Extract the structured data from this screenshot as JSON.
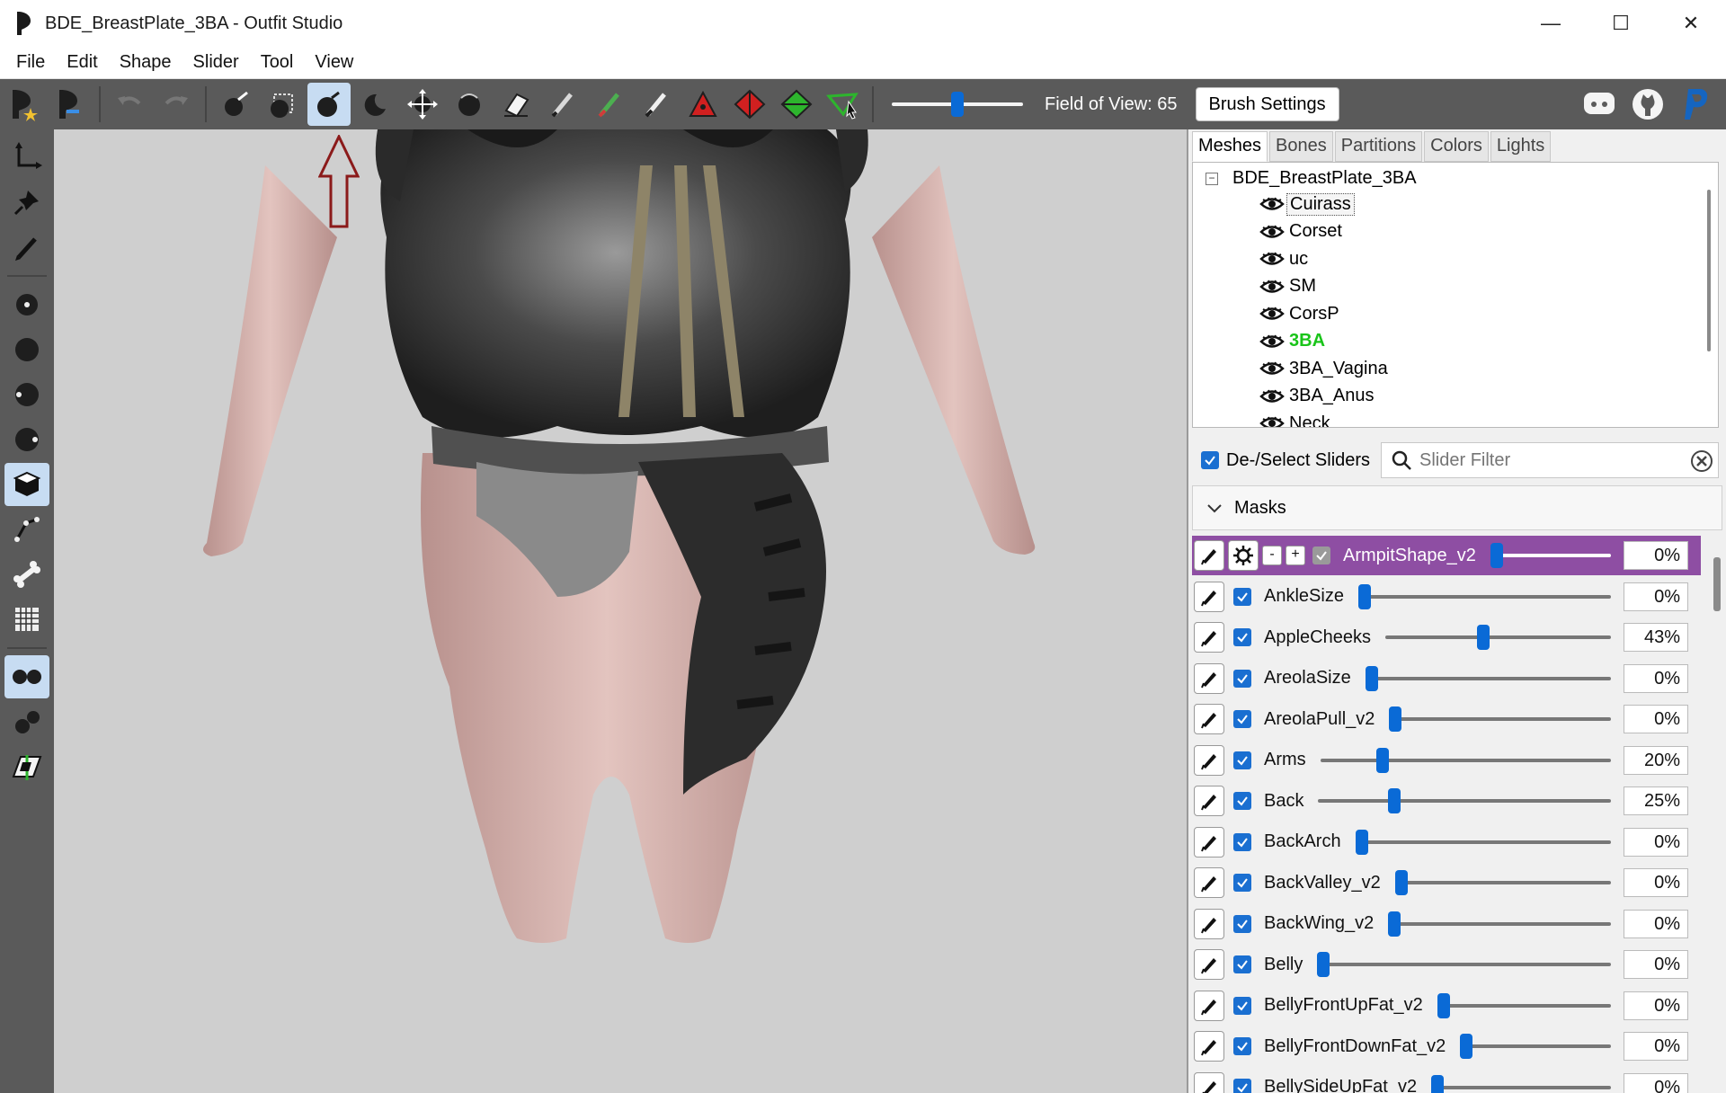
{
  "window": {
    "title": "BDE_BreastPlate_3BA - Outfit Studio",
    "minimize": "—",
    "maximize": "☐",
    "close": "✕"
  },
  "menu": [
    "File",
    "Edit",
    "Shape",
    "Slider",
    "Tool",
    "View"
  ],
  "toolbar": {
    "fov_label": "Field of View: 65",
    "fov_value": 65,
    "brush_settings_label": "Brush Settings",
    "active_tool": "inflate-brush"
  },
  "tabs": [
    {
      "label": "Meshes",
      "active": true
    },
    {
      "label": "Bones",
      "active": false
    },
    {
      "label": "Partitions",
      "active": false
    },
    {
      "label": "Colors",
      "active": false
    },
    {
      "label": "Lights",
      "active": false
    }
  ],
  "mesh_tree": {
    "root": "BDE_BreastPlate_3BA",
    "collapse_glyph": "−",
    "items": [
      {
        "label": "Cuirass",
        "state": "selected"
      },
      {
        "label": "Corset",
        "state": "normal"
      },
      {
        "label": "uc",
        "state": "normal"
      },
      {
        "label": "SM",
        "state": "normal"
      },
      {
        "label": "CorsP",
        "state": "normal"
      },
      {
        "label": "3BA",
        "state": "highlight"
      },
      {
        "label": "3BA_Vagina",
        "state": "normal"
      },
      {
        "label": "3BA_Anus",
        "state": "normal"
      },
      {
        "label": "Neck",
        "state": "normal"
      }
    ]
  },
  "slider_panel": {
    "deselect_label": "De-/Select Sliders",
    "filter_placeholder": "Slider Filter",
    "masks_label": "Masks",
    "minus": "-",
    "plus": "+",
    "sliders": [
      {
        "name": "ArmpitShape_v2",
        "value": "0%",
        "fraction": 0.0,
        "selected": true
      },
      {
        "name": "AnkleSize",
        "value": "0%",
        "fraction": 0.0
      },
      {
        "name": "AppleCheeks",
        "value": "43%",
        "fraction": 0.43
      },
      {
        "name": "AreolaSize",
        "value": "0%",
        "fraction": 0.0
      },
      {
        "name": "AreolaPull_v2",
        "value": "0%",
        "fraction": 0.0
      },
      {
        "name": "Arms",
        "value": "20%",
        "fraction": 0.2
      },
      {
        "name": "Back",
        "value": "25%",
        "fraction": 0.25
      },
      {
        "name": "BackArch",
        "value": "0%",
        "fraction": 0.0
      },
      {
        "name": "BackValley_v2",
        "value": "0%",
        "fraction": 0.0
      },
      {
        "name": "BackWing_v2",
        "value": "0%",
        "fraction": 0.0
      },
      {
        "name": "Belly",
        "value": "0%",
        "fraction": 0.0
      },
      {
        "name": "BellyFrontUpFat_v2",
        "value": "0%",
        "fraction": 0.0
      },
      {
        "name": "BellyFrontDownFat_v2",
        "value": "0%",
        "fraction": 0.0
      },
      {
        "name": "BellySideUpFat_v2",
        "value": "0%",
        "fraction": 0.0
      }
    ]
  },
  "colors": {
    "accent": "#0a6ad6",
    "selected_row": "#8e4ea3",
    "highlight_mesh": "#19c419",
    "toolbar_bg": "#5a5a5a",
    "viewport_bg": "#cfcfcf"
  }
}
